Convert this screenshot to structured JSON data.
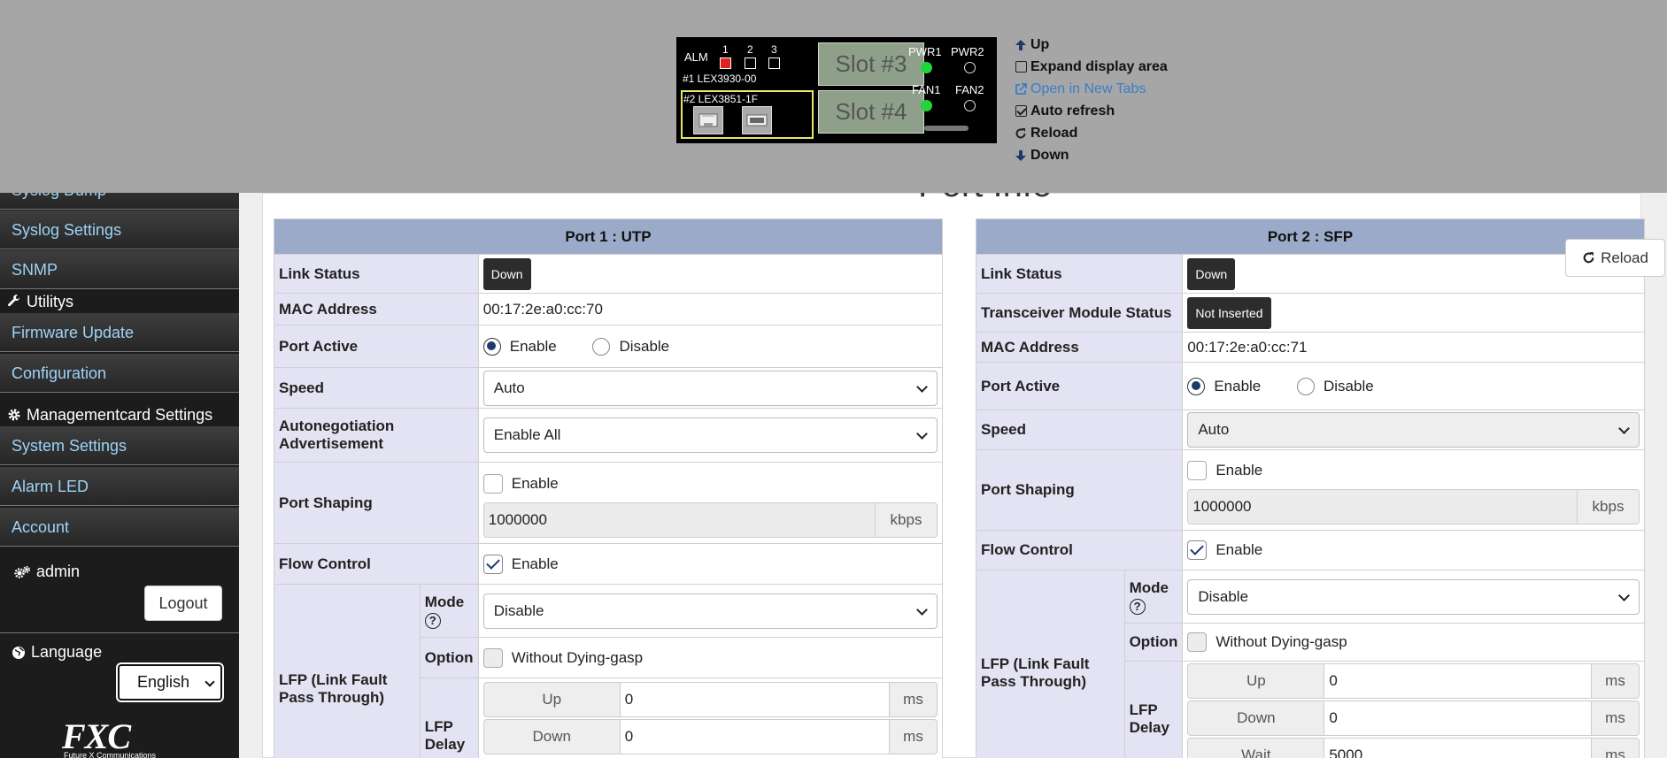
{
  "device": {
    "alm": "ALM",
    "led_numbers": [
      "1",
      "2",
      "3"
    ],
    "card1": "#1 LEX3930-00",
    "card2": "#2 LEX3851-1F",
    "slot3": "Slot #3",
    "slot4": "Slot #4",
    "pwr1": "PWR1",
    "pwr2": "PWR2",
    "fan1": "FAN1",
    "fan2": "FAN2"
  },
  "nav_controls": {
    "up": "Up",
    "expand": "Expand display area",
    "open_tabs": "Open in New Tabs",
    "auto_refresh": "Auto refresh",
    "reload": "Reload",
    "down": "Down"
  },
  "sidebar": {
    "items_top": [
      "Syslog Dump",
      "Syslog Settings",
      "SNMP"
    ],
    "section_utilities": "Utilitys",
    "items_utilities": [
      "Firmware Update",
      "Configuration"
    ],
    "section_mgmt": "Managementcard Settings",
    "items_mgmt": [
      "System Settings",
      "Alarm LED",
      "Account"
    ],
    "user": "admin",
    "logout": "Logout",
    "language_label": "Language",
    "language_value": "English",
    "logo": "FXC",
    "logo_sub": "Future X Communications"
  },
  "page": {
    "title": "Port Info",
    "reload_button": "Reload"
  },
  "port1": {
    "header": "Port 1 : UTP",
    "link_status_label": "Link Status",
    "link_status": "Down",
    "mac_label": "MAC Address",
    "mac": "00:17:2e:a0:cc:70",
    "port_active_label": "Port Active",
    "enable": "Enable",
    "disable": "Disable",
    "speed_label": "Speed",
    "speed": "Auto",
    "autoneg_label": "Autonegotiation Advertisement",
    "autoneg": "Enable All",
    "shaping_label": "Port Shaping",
    "shaping_enable": "Enable",
    "shaping_value": "1000000",
    "shaping_unit": "kbps",
    "flow_label": "Flow Control",
    "flow_enable": "Enable",
    "lfp_label": "LFP (Link Fault Pass Through)",
    "mode_label": "Mode",
    "mode": "Disable",
    "option_label": "Option",
    "option": "Without Dying-gasp",
    "delay_label": "LFP Delay",
    "up_label": "Up",
    "up_value": "0",
    "down_label": "Down",
    "down_value": "0",
    "ms": "ms"
  },
  "port2": {
    "header": "Port 2 : SFP",
    "link_status_label": "Link Status",
    "link_status": "Down",
    "transceiver_label": "Transceiver Module Status",
    "transceiver": "Not Inserted",
    "mac_label": "MAC Address",
    "mac": "00:17:2e:a0:cc:71",
    "port_active_label": "Port Active",
    "enable": "Enable",
    "disable": "Disable",
    "speed_label": "Speed",
    "speed": "Auto",
    "shaping_label": "Port Shaping",
    "shaping_enable": "Enable",
    "shaping_value": "1000000",
    "shaping_unit": "kbps",
    "flow_label": "Flow Control",
    "flow_enable": "Enable",
    "lfp_label": "LFP (Link Fault Pass Through)",
    "mode_label": "Mode",
    "mode": "Disable",
    "option_label": "Option",
    "option": "Without Dying-gasp",
    "delay_label": "LFP Delay",
    "up_label": "Up",
    "up_value": "0",
    "down_label": "Down",
    "down_value": "0",
    "wait_label": "Wait",
    "wait_value": "5000",
    "ms": "ms"
  },
  "colors": {
    "alarm_led": "#e0211f",
    "power_led_on": "#22d43a",
    "header_bg": "#9aaac8",
    "label_bg": "#e3e3f3",
    "sidebar_link": "#9dd3f7"
  }
}
